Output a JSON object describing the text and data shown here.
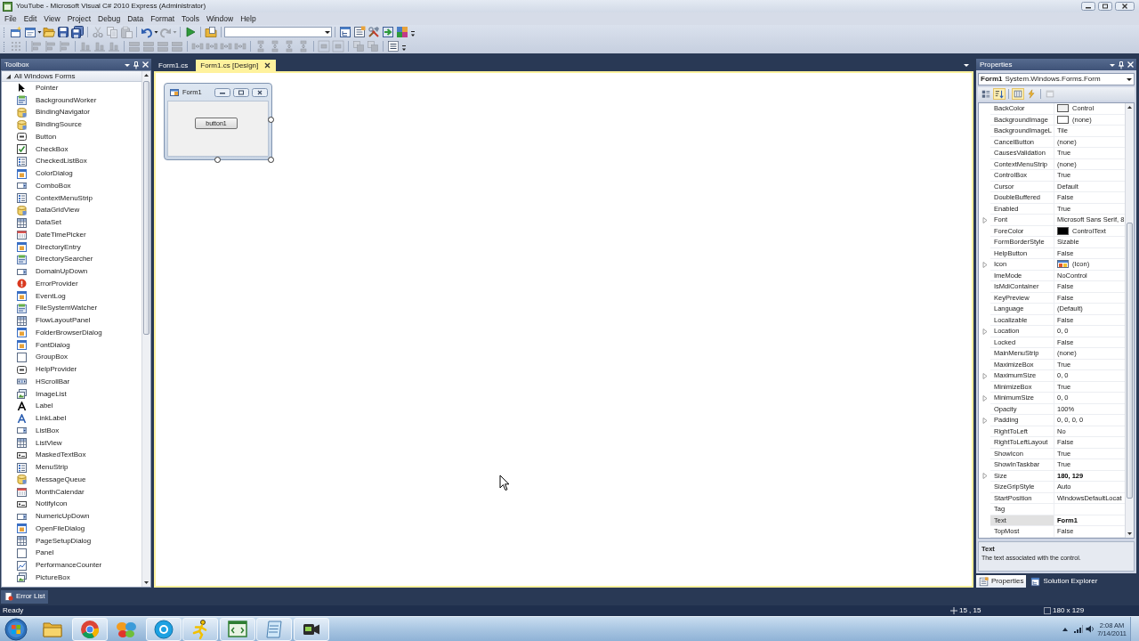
{
  "window": {
    "title": "YouTube - Microsoft Visual C# 2010 Express (Administrator)"
  },
  "menu": [
    "File",
    "Edit",
    "View",
    "Project",
    "Debug",
    "Data",
    "Format",
    "Tools",
    "Window",
    "Help"
  ],
  "toolbars": [
    {
      "buttons": [
        {
          "disabled": false
        },
        {
          "disabled": false
        },
        {
          "disabled": false
        },
        {
          "disabled": false
        },
        {
          "disabled": false
        },
        {
          "disabled": true
        },
        {
          "disabled": true
        },
        {
          "disabled": true
        },
        {
          "disabled": false
        },
        {
          "disabled": true
        },
        {
          "disabled": false
        },
        {
          "disabled": false
        },
        {
          "disabled": false
        },
        {
          "disabled": false
        },
        {
          "disabled": false
        },
        {
          "disabled": false
        },
        {
          "disabled": false
        }
      ]
    },
    {
      "buttons": [
        {
          "disabled": true
        },
        {
          "disabled": true
        },
        {
          "disabled": true
        },
        {
          "disabled": true
        },
        {
          "disabled": true
        },
        {
          "disabled": true
        },
        {
          "disabled": true
        },
        {
          "disabled": true
        },
        {
          "disabled": true
        },
        {
          "disabled": true
        },
        {
          "disabled": true
        },
        {
          "disabled": true
        },
        {
          "disabled": true
        },
        {
          "disabled": true
        },
        {
          "disabled": true
        },
        {
          "disabled": true
        },
        {
          "disabled": true
        },
        {
          "disabled": true
        },
        {
          "disabled": true
        },
        {
          "disabled": true
        },
        {
          "disabled": true
        },
        {
          "disabled": true
        },
        {
          "disabled": true
        },
        {
          "disabled": false
        }
      ]
    }
  ],
  "toolbox": {
    "title": "Toolbox",
    "group": {
      "label": "All Windows Forms",
      "expanded": true
    },
    "items": [
      {
        "label": "Pointer"
      },
      {
        "label": "BackgroundWorker"
      },
      {
        "label": "BindingNavigator"
      },
      {
        "label": "BindingSource"
      },
      {
        "label": "Button"
      },
      {
        "label": "CheckBox"
      },
      {
        "label": "CheckedListBox"
      },
      {
        "label": "ColorDialog"
      },
      {
        "label": "ComboBox"
      },
      {
        "label": "ContextMenuStrip"
      },
      {
        "label": "DataGridView"
      },
      {
        "label": "DataSet"
      },
      {
        "label": "DateTimePicker"
      },
      {
        "label": "DirectoryEntry"
      },
      {
        "label": "DirectorySearcher"
      },
      {
        "label": "DomainUpDown"
      },
      {
        "label": "ErrorProvider"
      },
      {
        "label": "EventLog"
      },
      {
        "label": "FileSystemWatcher"
      },
      {
        "label": "FlowLayoutPanel"
      },
      {
        "label": "FolderBrowserDialog"
      },
      {
        "label": "FontDialog"
      },
      {
        "label": "GroupBox"
      },
      {
        "label": "HelpProvider"
      },
      {
        "label": "HScrollBar"
      },
      {
        "label": "ImageList"
      },
      {
        "label": "Label"
      },
      {
        "label": "LinkLabel"
      },
      {
        "label": "ListBox"
      },
      {
        "label": "ListView"
      },
      {
        "label": "MaskedTextBox"
      },
      {
        "label": "MenuStrip"
      },
      {
        "label": "MessageQueue"
      },
      {
        "label": "MonthCalendar"
      },
      {
        "label": "NotifyIcon"
      },
      {
        "label": "NumericUpDown"
      },
      {
        "label": "OpenFileDialog"
      },
      {
        "label": "PageSetupDialog"
      },
      {
        "label": "Panel"
      },
      {
        "label": "PerformanceCounter"
      },
      {
        "label": "PictureBox"
      }
    ]
  },
  "document_tabs": [
    {
      "label": "Form1.cs",
      "selected": false
    },
    {
      "label": "Form1.cs [Design]",
      "selected": true
    }
  ],
  "designer": {
    "form": {
      "title": "Form1",
      "button": "button1",
      "selected": true
    }
  },
  "properties": {
    "title": "Properties",
    "object": {
      "name": "Form1",
      "type": "System.Windows.Forms.Form"
    },
    "view_buttons": [
      {
        "selected": false,
        "disabled": false
      },
      {
        "selected": true,
        "disabled": false
      },
      {
        "selected": true,
        "disabled": false
      },
      {
        "selected": false,
        "disabled": false
      },
      {
        "selected": false,
        "disabled": true
      }
    ],
    "rows": [
      {
        "name": "BackColor",
        "value": "Control",
        "kind": "color",
        "color": "#f0f0f0",
        "expandable": false,
        "modified": false,
        "selected": false
      },
      {
        "name": "BackgroundImage",
        "value": "(none)",
        "kind": "image",
        "expandable": false,
        "modified": false,
        "selected": false
      },
      {
        "name": "BackgroundImageL",
        "value": "Tile",
        "kind": "text",
        "expandable": false,
        "modified": false,
        "selected": false
      },
      {
        "name": "CancelButton",
        "value": "(none)",
        "kind": "text",
        "expandable": false,
        "modified": false,
        "selected": false
      },
      {
        "name": "CausesValidation",
        "value": "True",
        "kind": "text",
        "expandable": false,
        "modified": false,
        "selected": false
      },
      {
        "name": "ContextMenuStrip",
        "value": "(none)",
        "kind": "text",
        "expandable": false,
        "modified": false,
        "selected": false
      },
      {
        "name": "ControlBox",
        "value": "True",
        "kind": "text",
        "expandable": false,
        "modified": false,
        "selected": false
      },
      {
        "name": "Cursor",
        "value": "Default",
        "kind": "text",
        "expandable": false,
        "modified": false,
        "selected": false
      },
      {
        "name": "DoubleBuffered",
        "value": "False",
        "kind": "text",
        "expandable": false,
        "modified": false,
        "selected": false
      },
      {
        "name": "Enabled",
        "value": "True",
        "kind": "text",
        "expandable": false,
        "modified": false,
        "selected": false
      },
      {
        "name": "Font",
        "value": "Microsoft Sans Serif, 8",
        "kind": "text",
        "expandable": true,
        "modified": false,
        "selected": false
      },
      {
        "name": "ForeColor",
        "value": "ControlText",
        "kind": "color",
        "color": "#000000",
        "expandable": false,
        "modified": false,
        "selected": false
      },
      {
        "name": "FormBorderStyle",
        "value": "Sizable",
        "kind": "text",
        "expandable": false,
        "modified": false,
        "selected": false
      },
      {
        "name": "HelpButton",
        "value": "False",
        "kind": "text",
        "expandable": false,
        "modified": false,
        "selected": false
      },
      {
        "name": "Icon",
        "value": "(Icon)",
        "kind": "icon",
        "expandable": true,
        "modified": false,
        "selected": false
      },
      {
        "name": "ImeMode",
        "value": "NoControl",
        "kind": "text",
        "expandable": false,
        "modified": false,
        "selected": false
      },
      {
        "name": "IsMdiContainer",
        "value": "False",
        "kind": "text",
        "expandable": false,
        "modified": false,
        "selected": false
      },
      {
        "name": "KeyPreview",
        "value": "False",
        "kind": "text",
        "expandable": false,
        "modified": false,
        "selected": false
      },
      {
        "name": "Language",
        "value": "(Default)",
        "kind": "text",
        "expandable": false,
        "modified": false,
        "selected": false
      },
      {
        "name": "Localizable",
        "value": "False",
        "kind": "text",
        "expandable": false,
        "modified": false,
        "selected": false
      },
      {
        "name": "Location",
        "value": "0, 0",
        "kind": "text",
        "expandable": true,
        "modified": false,
        "selected": false
      },
      {
        "name": "Locked",
        "value": "False",
        "kind": "text",
        "expandable": false,
        "modified": false,
        "selected": false
      },
      {
        "name": "MainMenuStrip",
        "value": "(none)",
        "kind": "text",
        "expandable": false,
        "modified": false,
        "selected": false
      },
      {
        "name": "MaximizeBox",
        "value": "True",
        "kind": "text",
        "expandable": false,
        "modified": false,
        "selected": false
      },
      {
        "name": "MaximumSize",
        "value": "0, 0",
        "kind": "text",
        "expandable": true,
        "modified": false,
        "selected": false
      },
      {
        "name": "MinimizeBox",
        "value": "True",
        "kind": "text",
        "expandable": false,
        "modified": false,
        "selected": false
      },
      {
        "name": "MinimumSize",
        "value": "0, 0",
        "kind": "text",
        "expandable": true,
        "modified": false,
        "selected": false
      },
      {
        "name": "Opacity",
        "value": "100%",
        "kind": "text",
        "expandable": false,
        "modified": false,
        "selected": false
      },
      {
        "name": "Padding",
        "value": "0, 0, 0, 0",
        "kind": "text",
        "expandable": true,
        "modified": false,
        "selected": false
      },
      {
        "name": "RightToLeft",
        "value": "No",
        "kind": "text",
        "expandable": false,
        "modified": false,
        "selected": false
      },
      {
        "name": "RightToLeftLayout",
        "value": "False",
        "kind": "text",
        "expandable": false,
        "modified": false,
        "selected": false
      },
      {
        "name": "ShowIcon",
        "value": "True",
        "kind": "text",
        "expandable": false,
        "modified": false,
        "selected": false
      },
      {
        "name": "ShowInTaskbar",
        "value": "True",
        "kind": "text",
        "expandable": false,
        "modified": false,
        "selected": false
      },
      {
        "name": "Size",
        "value": "180, 129",
        "kind": "text",
        "expandable": true,
        "modified": true,
        "selected": false
      },
      {
        "name": "SizeGripStyle",
        "value": "Auto",
        "kind": "text",
        "expandable": false,
        "modified": false,
        "selected": false
      },
      {
        "name": "StartPosition",
        "value": "WindowsDefaultLocat",
        "kind": "text",
        "expandable": false,
        "modified": false,
        "selected": false
      },
      {
        "name": "Tag",
        "kind": "text",
        "expandable": false,
        "selected": false
      },
      {
        "name": "Text",
        "value": "Form1",
        "kind": "text",
        "expandable": false,
        "modified": true,
        "selected": true
      },
      {
        "name": "TopMost",
        "value": "False",
        "kind": "text",
        "expandable": false,
        "modified": false,
        "selected": false
      }
    ],
    "description": {
      "title": "Text",
      "text": "The text associated with the control."
    },
    "tabs": [
      {
        "label": "Properties",
        "selected": true
      },
      {
        "label": "Solution Explorer",
        "selected": false
      }
    ]
  },
  "error_list": {
    "label": "Error List"
  },
  "status_bar": {
    "text": "Ready",
    "position": "15 , 15",
    "size": "180 x 129"
  },
  "taskbar": {
    "apps": [
      {
        "running": false
      },
      {
        "running": true
      },
      {
        "running": false
      },
      {
        "running": true
      },
      {
        "running": true
      },
      {
        "running": true
      },
      {
        "running": true
      },
      {
        "running": true
      }
    ],
    "clock": {
      "time": "2:08 AM",
      "date": "7/14/2011"
    }
  }
}
